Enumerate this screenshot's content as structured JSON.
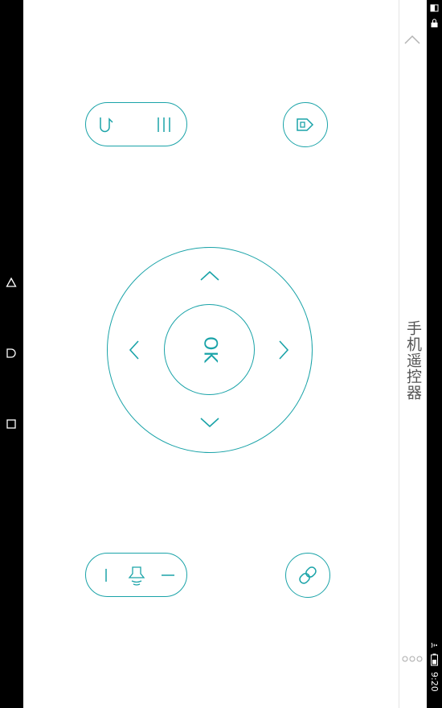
{
  "app": {
    "title": "手机遥控器"
  },
  "status_bar": {
    "time": "下午9:20"
  },
  "colors": {
    "accent": "#1aa3a8",
    "panel_text": "#555555",
    "nav_bg": "#000000"
  },
  "nav_bar": {
    "icons": [
      "back-icon",
      "home-icon",
      "recents-icon"
    ]
  },
  "remote": {
    "ok_label": "OK",
    "buttons": [
      "back-button",
      "menu-button",
      "home-button",
      "volume-down-button",
      "mute-button",
      "volume-up-button",
      "link-button",
      "dpad-up",
      "dpad-down",
      "dpad-left",
      "dpad-right"
    ]
  },
  "side_panel": {
    "icons": [
      "collapse-chevron-icon",
      "more-dots-icon"
    ]
  }
}
